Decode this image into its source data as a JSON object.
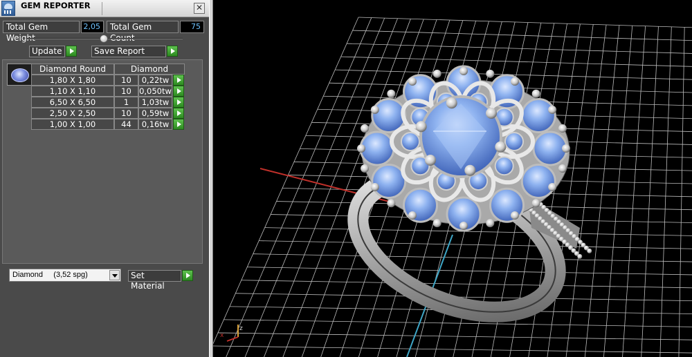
{
  "window": {
    "title": "GEM REPORTER",
    "close_glyph": "✕"
  },
  "totals": {
    "weight_label": "Total Gem Weight",
    "weight_value": "2,05",
    "count_label": "Total Gem Count",
    "count_value": "75"
  },
  "actions": {
    "update_label": "Update",
    "save_report_label": "Save Report"
  },
  "table": {
    "headers": [
      "Diamond Round",
      "Diamond"
    ],
    "rows": [
      {
        "size": "1,80 X 1,80",
        "count": "10",
        "weight": "0,22tw"
      },
      {
        "size": "1,10 X 1,10",
        "count": "10",
        "weight": "0,050tw"
      },
      {
        "size": "6,50 X 6,50",
        "count": "1",
        "weight": "1,03tw"
      },
      {
        "size": "2,50 X 2,50",
        "count": "10",
        "weight": "0,59tw"
      },
      {
        "size": "1,00 X 1,00",
        "count": "44",
        "weight": "0,16tw"
      }
    ]
  },
  "material": {
    "selected": "Diamond     (3,52 spg)",
    "set_label": "Set Material"
  },
  "viewport": {
    "axis_labels": {
      "x": "x",
      "z": "z"
    }
  },
  "icons": [
    "app-icon",
    "close-icon",
    "play-arrow-icon",
    "gem-thumbnail-icon",
    "dropdown-arrow-icon"
  ],
  "colors": {
    "value_text": "#6fc3ff",
    "go_button": "#3ea32e",
    "gem_blue": "#7fa6e8",
    "grid": "#bdbdbd",
    "x_axis": "#c0302a",
    "y_axis": "#3fa6c6"
  }
}
